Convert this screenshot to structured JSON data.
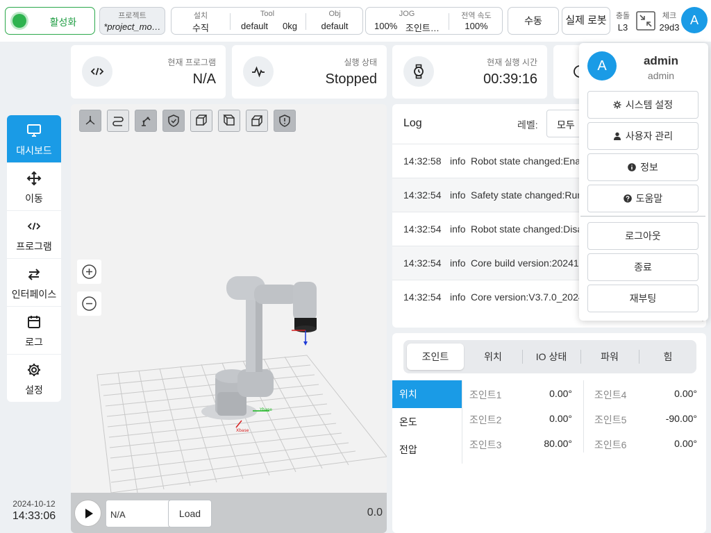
{
  "topbar": {
    "activate_label": "활성화",
    "project_caption": "프로젝트",
    "project_value": "*project_mo…",
    "install_caption": "설치",
    "install_value": "수직",
    "tool_caption": "Tool",
    "tool_value": "default",
    "tool_weight": "0kg",
    "obj_caption": "Obj",
    "obj_value": "default",
    "jog_caption": "JOG",
    "jog_percent": "100%",
    "jog_mode": "조인트…",
    "global_speed_caption": "전역 속도",
    "global_speed_value": "100%",
    "manual_label": "수동",
    "real_robot_label": "실제 로봇",
    "collision_caption": "충돌",
    "collision_value": "L3",
    "check_caption": "체크",
    "check_value": "29d3",
    "avatar_letter": "A"
  },
  "sidebar": {
    "items": [
      {
        "label": "대시보드",
        "icon": "monitor-icon"
      },
      {
        "label": "이동",
        "icon": "move-icon"
      },
      {
        "label": "프로그램",
        "icon": "code-icon"
      },
      {
        "label": "인터페이스",
        "icon": "swap-icon"
      },
      {
        "label": "로그",
        "icon": "calendar-icon"
      },
      {
        "label": "설정",
        "icon": "gear-icon"
      }
    ],
    "date": "2024-10-12",
    "time": "14:33:06"
  },
  "cards": {
    "program_caption": "현재 프로그램",
    "program_value": "N/A",
    "state_caption": "실행 상태",
    "state_value": "Stopped",
    "runtime_caption": "현재 실행 시간",
    "runtime_value": "00:39:16"
  },
  "view3d": {
    "program_field": "N/A",
    "load_label": "Load",
    "speed_value": "0.0"
  },
  "log": {
    "title": "Log",
    "level_label": "레벨:",
    "level_value": "모두",
    "rows": [
      {
        "time": "14:32:58",
        "level": "info",
        "message": "Robot state changed:Enabled"
      },
      {
        "time": "14:32:54",
        "level": "info",
        "message": "Safety state changed:Running"
      },
      {
        "time": "14:32:54",
        "level": "info",
        "message": "Robot state changed:Disabled"
      },
      {
        "time": "14:32:54",
        "level": "info",
        "message": "Core build version:20241010"
      },
      {
        "time": "14:32:54",
        "level": "info",
        "message": "Core version:V3.7.0_2024"
      }
    ]
  },
  "joints": {
    "tabs": [
      "조인트",
      "위치",
      "IO 상태",
      "파워",
      "힘"
    ],
    "subtabs": [
      "위치",
      "온도",
      "전압"
    ],
    "items": [
      {
        "name": "조인트1",
        "value": "0.00°"
      },
      {
        "name": "조인트2",
        "value": "0.00°"
      },
      {
        "name": "조인트3",
        "value": "80.00°"
      },
      {
        "name": "조인트4",
        "value": "0.00°"
      },
      {
        "name": "조인트5",
        "value": "-90.00°"
      },
      {
        "name": "조인트6",
        "value": "0.00°"
      }
    ]
  },
  "user_menu": {
    "avatar_letter": "A",
    "name": "admin",
    "role": "admin",
    "system_settings": "시스템 설정",
    "user_management": "사용자 관리",
    "info": "정보",
    "help": "도움말",
    "logout": "로그아웃",
    "quit": "종료",
    "reboot": "재부팅"
  },
  "colors": {
    "accent": "#1a9be6",
    "active_green": "#2eb34f"
  }
}
